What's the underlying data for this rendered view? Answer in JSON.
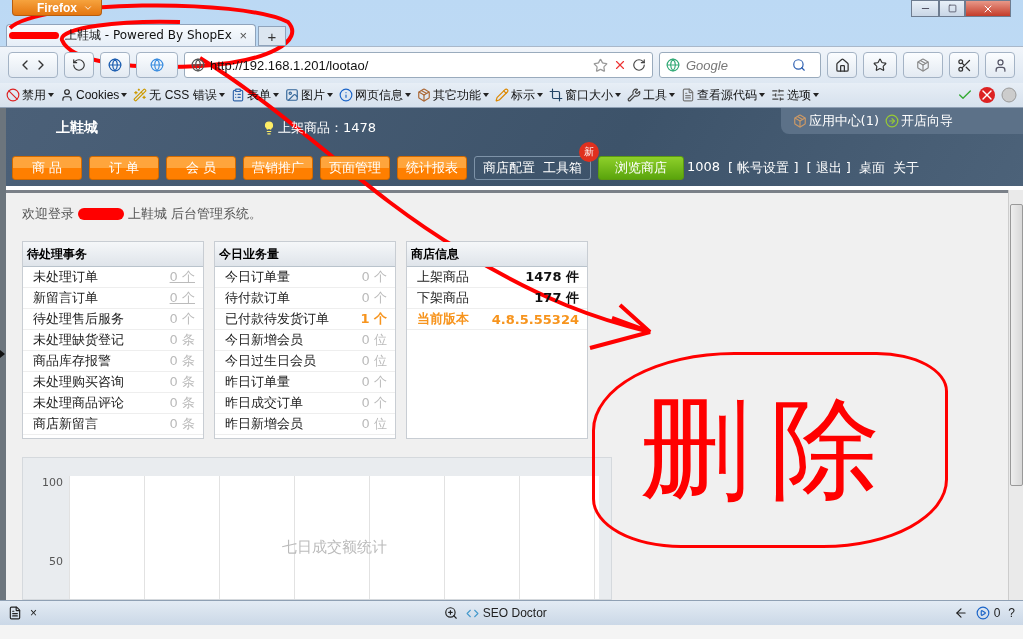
{
  "browser": {
    "menu_button": "Firefox",
    "tab": {
      "title": "上鞋城 - Powered By ShopEx",
      "close": "×"
    },
    "new_tab": "+",
    "url": "http://192.168.1.201/lootao/",
    "search_placeholder": "Google"
  },
  "dev_toolbar": [
    {
      "label": "禁用"
    },
    {
      "label": "Cookies"
    },
    {
      "label": "无 CSS 错误"
    },
    {
      "label": "表单"
    },
    {
      "label": "图片"
    },
    {
      "label": "网页信息"
    },
    {
      "label": "其它功能"
    },
    {
      "label": "标示"
    },
    {
      "label": "窗口大小"
    },
    {
      "label": "工具"
    },
    {
      "label": "查看源代码"
    },
    {
      "label": "选项"
    }
  ],
  "header": {
    "store_name": "上鞋城",
    "notice": "上架商品：1478",
    "links": [
      "应用中心(1)",
      "开店向导"
    ]
  },
  "nav": [
    {
      "label": "商 品",
      "kind": "orange"
    },
    {
      "label": "订 单",
      "kind": "orange"
    },
    {
      "label": "会 员",
      "kind": "orange"
    },
    {
      "label": "营销推广",
      "kind": "orange"
    },
    {
      "label": "页面管理",
      "kind": "orange"
    },
    {
      "label": "统计报表",
      "kind": "orange"
    },
    {
      "label": "商店配置",
      "kind": "plain"
    },
    {
      "label": "工具箱",
      "kind": "plain",
      "badge": "新"
    },
    {
      "label": "浏览商店",
      "kind": "green"
    }
  ],
  "user_links": [
    "1008",
    "[ 帐号设置 ]",
    "[ 退出 ]",
    "桌面",
    "关于"
  ],
  "welcome": {
    "prefix": "欢迎登录",
    "suffix": "上鞋城 后台管理系统。"
  },
  "panels": [
    {
      "title": "待处理事务",
      "rows": [
        {
          "label": "未处理订单",
          "value": "0 个",
          "kind": "link"
        },
        {
          "label": "新留言订单",
          "value": "0 个",
          "kind": "link"
        },
        {
          "label": "待处理售后服务",
          "value": "0 个",
          "kind": "muted"
        },
        {
          "label": "未处理缺货登记",
          "value": "0 条",
          "kind": "muted"
        },
        {
          "label": "商品库存报警",
          "value": "0 条",
          "kind": "muted"
        },
        {
          "label": "未处理购买咨询",
          "value": "0 条",
          "kind": "muted"
        },
        {
          "label": "未处理商品评论",
          "value": "0 条",
          "kind": "muted"
        },
        {
          "label": "商店新留言",
          "value": "0 条",
          "kind": "muted"
        }
      ]
    },
    {
      "title": "今日业务量",
      "rows": [
        {
          "label": "今日订单量",
          "value": "0 个",
          "kind": "muted"
        },
        {
          "label": "待付款订单",
          "value": "0 个",
          "kind": "muted"
        },
        {
          "label": "已付款待发货订单",
          "value": "1 个",
          "kind": "accent"
        },
        {
          "label": "今日新增会员",
          "value": "0 位",
          "kind": "muted"
        },
        {
          "label": "今日过生日会员",
          "value": "0 位",
          "kind": "muted"
        },
        {
          "label": "昨日订单量",
          "value": "0 个",
          "kind": "muted"
        },
        {
          "label": "昨日成交订单",
          "value": "0 个",
          "kind": "muted"
        },
        {
          "label": "昨日新增会员",
          "value": "0 位",
          "kind": "muted"
        }
      ]
    },
    {
      "title": "商店信息",
      "rows": [
        {
          "label": "上架商品",
          "value": "1478 件",
          "kind": "strong"
        },
        {
          "label": "下架商品",
          "value": "177 件",
          "kind": "strong"
        },
        {
          "label": "当前版本",
          "value": "4.8.5.55324",
          "kind": "version"
        }
      ]
    }
  ],
  "chart": {
    "title": "七日成交额统计",
    "yticks": [
      "100",
      "50"
    ]
  },
  "status_bar": {
    "close": "×",
    "seo": "SEO Doctor",
    "count": "0",
    "help": "?"
  },
  "annotation": {
    "text": "删除"
  }
}
